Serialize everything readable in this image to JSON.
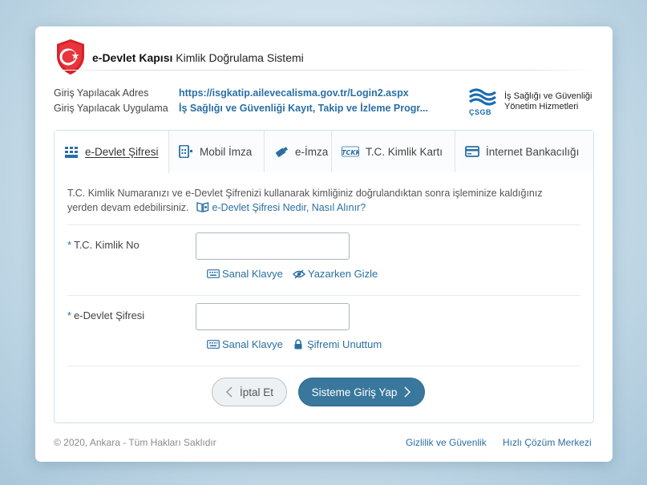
{
  "header": {
    "brand_bold": "e-Devlet Kapısı",
    "brand_rest": "Kimlik Doğrulama Sistemi"
  },
  "meta": {
    "address_label": "Giriş Yapılacak Adres",
    "address_value": "https://isgkatip.ailevecalisma.gov.tr/Login2.aspx",
    "app_label": "Giriş Yapılacak Uygulama",
    "app_value": "İş Sağlığı ve Güvenliği Kayıt, Takip ve İzleme Progr..."
  },
  "partner": {
    "line1": "İş Sağlığı ve Güvenliği",
    "line2": "Yönetim Hizmetleri",
    "abbr": "ÇSGB"
  },
  "tabs": [
    {
      "label": "e-Devlet Şifresi",
      "icon": "keypad-icon",
      "active": true
    },
    {
      "label": "Mobil İmza",
      "icon": "mobile-signature-icon",
      "active": false
    },
    {
      "label": "e-İmza",
      "icon": "usb-token-icon",
      "active": false
    },
    {
      "label": "T.C. Kimlik Kartı",
      "icon": "id-card-icon",
      "active": false
    },
    {
      "label": "İnternet Bankacılığı",
      "icon": "credit-card-icon",
      "active": false
    }
  ],
  "description": {
    "text": "T.C. Kimlik Numaranızı ve e-Devlet Şifrenizi kullanarak kimliğiniz doğrulandıktan sonra işleminize kaldığınız yerden devam edebilirsiniz.",
    "help_link": "e-Devlet Şifresi Nedir, Nasıl Alınır?"
  },
  "form": {
    "required_mark": "*",
    "tc_label": "T.C. Kimlik No",
    "tc_value": "",
    "password_label": "e-Devlet Şifresi",
    "password_value": "",
    "virtual_keyboard": "Sanal Klavye",
    "hide_while_typing": "Yazarken Gizle",
    "forgot_password": "Şifremi Unuttum"
  },
  "buttons": {
    "cancel": "İptal Et",
    "login": "Sisteme Giriş Yap"
  },
  "footer": {
    "copyright": "© 2020, Ankara - Tüm Hakları Saklıdır",
    "privacy": "Gizlilik ve Güvenlik",
    "help_center": "Hızlı Çözüm Merkezi"
  },
  "colors": {
    "accent": "#2a6fa3",
    "login_button": "#3a779c",
    "logo_red": "#d6222a"
  }
}
